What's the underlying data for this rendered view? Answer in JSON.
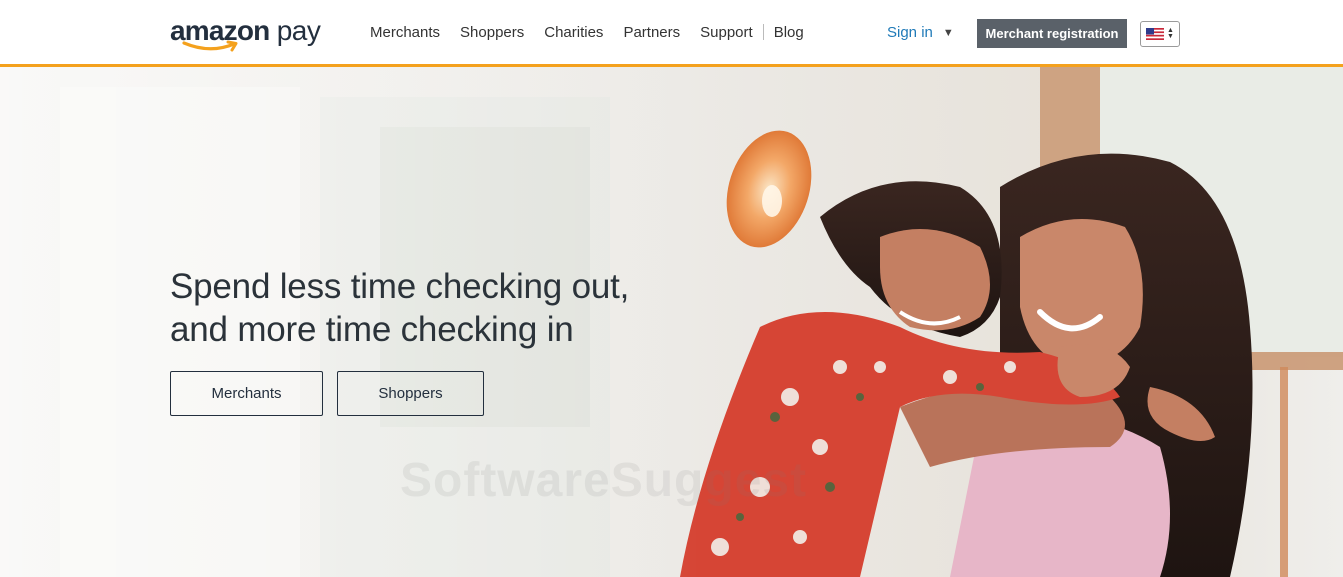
{
  "brand": {
    "logo_amazon": "amazon",
    "logo_pay": "pay",
    "accent_color": "#f4a11d",
    "link_color": "#1f7ab8"
  },
  "nav": {
    "items": [
      {
        "label": "Merchants"
      },
      {
        "label": "Shoppers"
      },
      {
        "label": "Charities"
      },
      {
        "label": "Partners"
      },
      {
        "label": "Support"
      },
      {
        "label": "Blog"
      }
    ]
  },
  "header": {
    "signin_label": "Sign in",
    "signin_icon": "caret-down-icon",
    "register_label": "Merchant registration",
    "locale_icon": "us-flag-icon"
  },
  "hero": {
    "headline_line1": "Spend less time checking out,",
    "headline_line2": "and more time checking in",
    "cta_merchants": "Merchants",
    "cta_shoppers": "Shoppers",
    "watermark": "SoftwareSuggest"
  }
}
